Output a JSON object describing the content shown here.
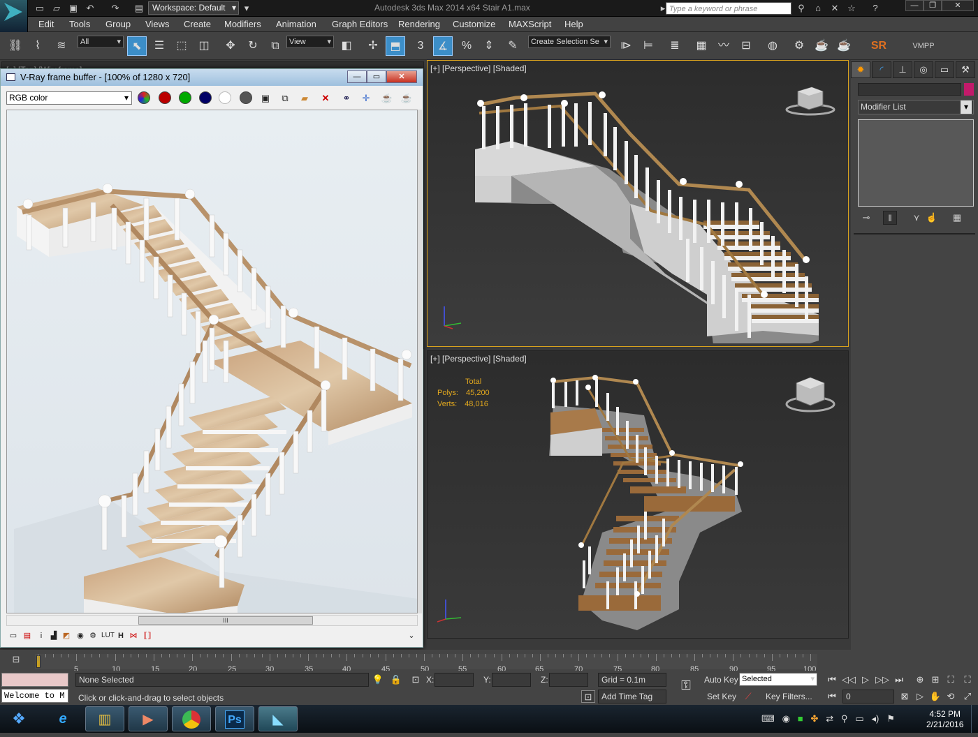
{
  "app": {
    "workspace": "Workspace: Default",
    "title": "Autodesk 3ds Max  2014 x64      Stair A1.max",
    "search_placeholder": "Type a keyword or phrase",
    "logo_text": "MAX"
  },
  "menus": [
    "Edit",
    "Tools",
    "Group",
    "Views",
    "Create",
    "Modifiers",
    "Animation",
    "Graph Editors",
    "Rendering",
    "Customize",
    "MAXScript",
    "Help"
  ],
  "toolbar": {
    "filter": "All",
    "ref_coord": "View",
    "selection_set": "Create Selection Se",
    "sr_label": "SR",
    "vmpp_label": "VMPP",
    "snap_label": "3"
  },
  "vray": {
    "title": "V-Ray frame buffer - [100% of 1280 x 720]",
    "channel": "RGB color",
    "scroll_label": "III",
    "bottom_labels": {
      "lut": "LUT",
      "h": "H"
    }
  },
  "viewports": {
    "top_left_label": "[+] [Top] [Wireframe]",
    "top_right_label": "[+] [Perspective] [Shaded]",
    "bottom_right_label": "[+] [Perspective] [Shaded]",
    "stats": {
      "title": "Total",
      "polys_label": "Polys:",
      "polys": "45,200",
      "verts_label": "Verts:",
      "verts": "48,016"
    },
    "accent": "#e2a81e"
  },
  "command_panel": {
    "modifier_list": "Modifier List"
  },
  "timeline": {
    "ticks": [
      "5",
      "10",
      "15",
      "20",
      "25",
      "30",
      "35",
      "40",
      "45",
      "50",
      "55",
      "60",
      "65",
      "70",
      "75",
      "80",
      "85",
      "90",
      "95",
      "100"
    ],
    "frame": "0"
  },
  "status": {
    "selection": "None Selected",
    "prompt": "Click or click-and-drag to select objects",
    "listener": "Welcome to M",
    "x_label": "X:",
    "y_label": "Y:",
    "z_label": "Z:",
    "grid": "Grid = 0.1m",
    "add_time_tag": "Add Time Tag",
    "auto_key": "Auto Key",
    "set_key": "Set Key",
    "key_mode": "Selected",
    "key_filters": "Key Filters...",
    "current_frame": "0"
  },
  "taskbar": {
    "time": "4:52 PM",
    "date": "2/21/2016",
    "ps_label": "Ps"
  }
}
